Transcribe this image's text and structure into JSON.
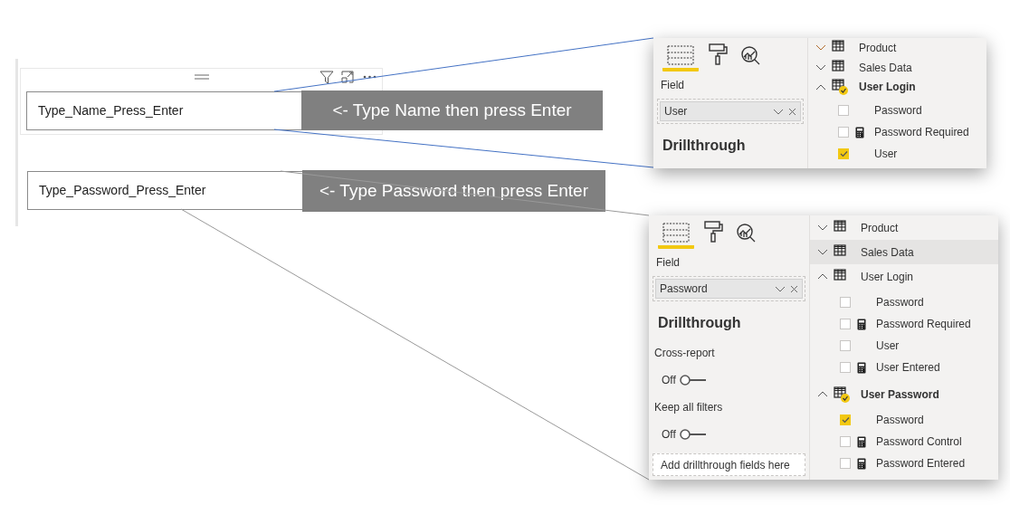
{
  "inputs": [
    {
      "value": "Type_Name_Press_Enter",
      "callout": "<- Type Name then press Enter"
    },
    {
      "value": "Type_Password_Press_Enter",
      "callout": "<- Type Password then press Enter"
    }
  ],
  "panels": [
    {
      "tabs": [
        {
          "selected": true
        },
        {
          "selected": false
        },
        {
          "selected": false
        }
      ],
      "field_label": "Field",
      "field_value": "User",
      "heading": "Drillthrough",
      "tables": [
        {
          "name": "Product",
          "expanded": false,
          "hovered": false,
          "has_selection": false
        },
        {
          "name": "Sales Data",
          "expanded": false,
          "hovered": false,
          "has_selection": false
        },
        {
          "name": "User Login",
          "expanded": true,
          "hovered": false,
          "has_selection": true,
          "children": [
            {
              "name": "Password",
              "kind": "column",
              "checked": false
            },
            {
              "name": "Password Required",
              "kind": "measure",
              "checked": false
            },
            {
              "name": "User",
              "kind": "column",
              "checked": true
            }
          ]
        }
      ]
    },
    {
      "tabs": [
        {
          "selected": true
        },
        {
          "selected": false
        },
        {
          "selected": false
        }
      ],
      "field_label": "Field",
      "field_value": "Password",
      "heading": "Drillthrough",
      "options": [
        {
          "label": "Cross-report",
          "toggle": "Off",
          "on": false
        },
        {
          "label": "Keep all filters",
          "toggle": "Off",
          "on": false
        }
      ],
      "drop_zone": "Add drillthrough fields here",
      "tables": [
        {
          "name": "Product",
          "expanded": false,
          "hovered": false,
          "has_selection": false
        },
        {
          "name": "Sales Data",
          "expanded": false,
          "hovered": true,
          "has_selection": false
        },
        {
          "name": "User Login",
          "expanded": true,
          "hovered": false,
          "has_selection": false,
          "children": [
            {
              "name": "Password",
              "kind": "column",
              "checked": false
            },
            {
              "name": "Password Required",
              "kind": "measure",
              "checked": false
            },
            {
              "name": "User",
              "kind": "column",
              "checked": false
            },
            {
              "name": "User Entered",
              "kind": "measure",
              "checked": false
            }
          ]
        },
        {
          "name": "User Password",
          "expanded": true,
          "hovered": false,
          "has_selection": true,
          "children": [
            {
              "name": "Password",
              "kind": "column",
              "checked": true
            },
            {
              "name": "Password Control",
              "kind": "measure",
              "checked": false
            },
            {
              "name": "Password Entered",
              "kind": "measure",
              "checked": false
            }
          ]
        }
      ]
    }
  ]
}
